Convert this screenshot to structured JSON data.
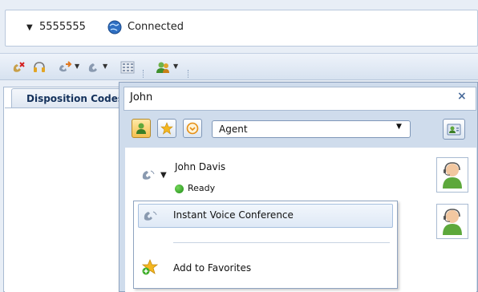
{
  "status": {
    "number": "5555555",
    "state": "Connected"
  },
  "toolbar": {
    "icons": [
      "transfer-off-icon",
      "headset-icon",
      "forward-call-icon",
      "phone-call-icon",
      "dialpad-icon",
      "directory-icon"
    ]
  },
  "left_panel": {
    "tab_label": "Disposition Codes"
  },
  "directory": {
    "search_value": "John",
    "close_glyph": "×",
    "filter_selected": "Agent",
    "contacts": [
      {
        "name": "John Davis",
        "status": "Ready"
      }
    ]
  },
  "context_menu": {
    "items": [
      {
        "label": "Instant Voice Conference",
        "icon": "phone-icon"
      },
      {
        "label": "Add to Favorites",
        "icon": "star-add-icon"
      }
    ]
  },
  "colors": {
    "ready": "#2aa52a",
    "accent": "#4a6c9b",
    "favorite_active": "#f5c04f"
  }
}
